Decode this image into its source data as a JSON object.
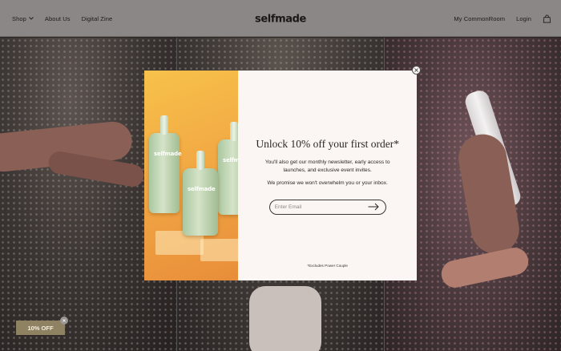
{
  "header": {
    "nav_left": [
      "Shop",
      "About Us",
      "Digital Zine"
    ],
    "logo": "selfmade",
    "nav_right": [
      "My CommonRoom",
      "Login"
    ]
  },
  "modal": {
    "headline": "Unlock 10% off your first order*",
    "subtext": "You'll also get our monthly newsletter, early access to launches, and exclusive event invites.",
    "subtext2": "We promise we won't overwhelm you or your inbox.",
    "email_placeholder": "Enter Email",
    "footnote": "*Excludes Power Couple",
    "bottle_labels": [
      "selfmade",
      "selfmade",
      "selfmade"
    ]
  },
  "discount_tab": {
    "label": "10% OFF"
  },
  "icons": {
    "dropdown": "chevron-down-icon",
    "cart": "shopping-bag-icon",
    "close": "close-icon",
    "submit": "arrow-right-icon"
  },
  "colors": {
    "header_bg": "#8a8786",
    "modal_bg": "#fbf6f3",
    "image_bg": "#f2a744",
    "discount_bg": "#8e8263"
  }
}
